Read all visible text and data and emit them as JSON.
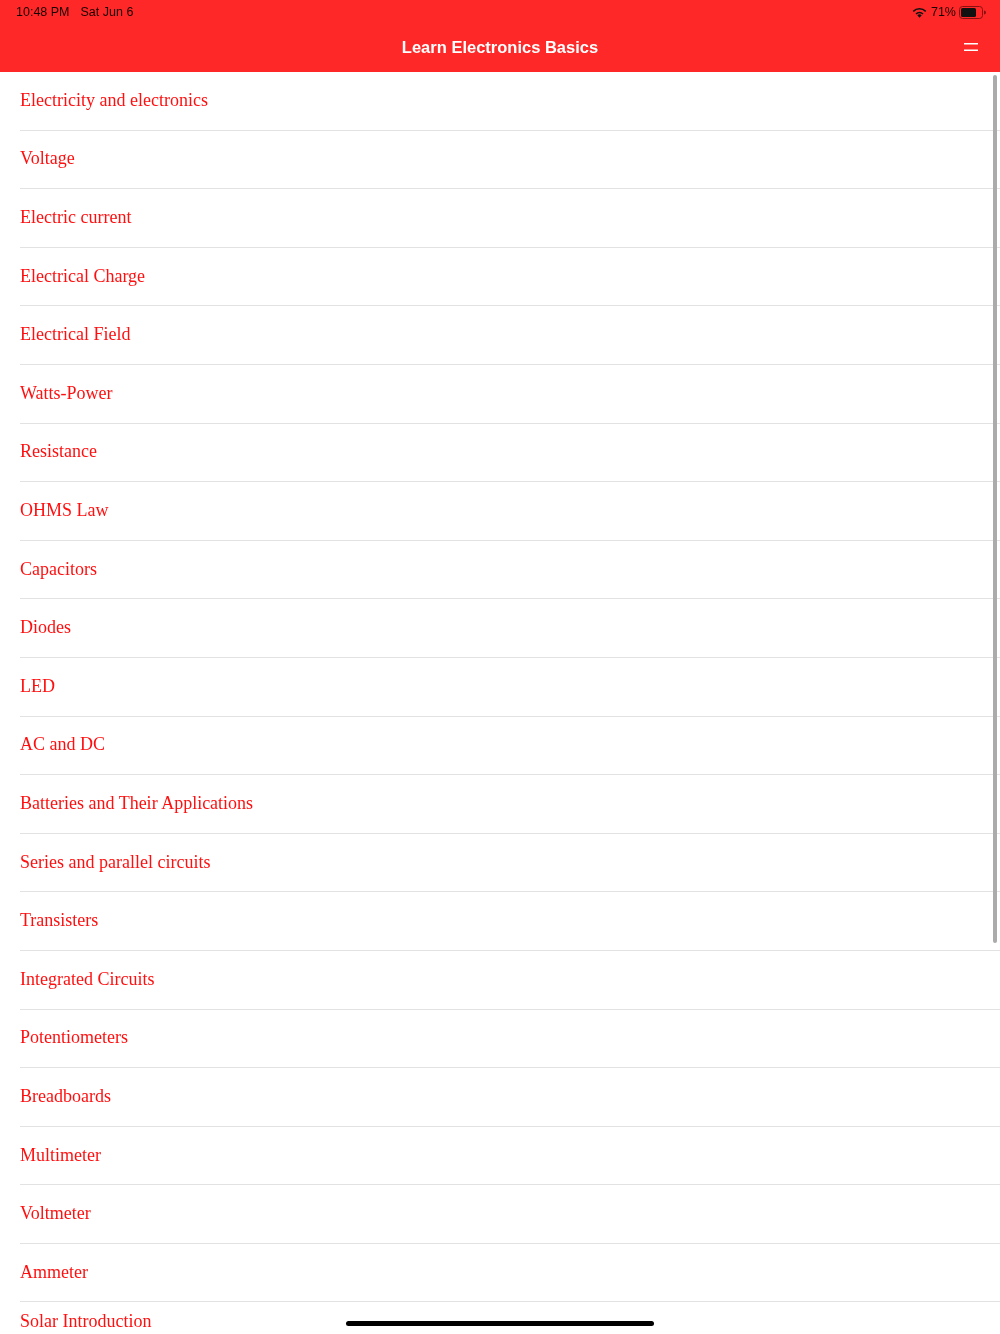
{
  "status_bar": {
    "time": "10:48 PM",
    "date": "Sat Jun 6",
    "battery": "71%"
  },
  "nav_bar": {
    "title": "Learn Electronics Basics"
  },
  "topics": [
    {
      "label": "Electricity and electronics"
    },
    {
      "label": "Voltage"
    },
    {
      "label": "Electric current"
    },
    {
      "label": "Electrical Charge"
    },
    {
      "label": "Electrical Field"
    },
    {
      "label": "Watts-Power"
    },
    {
      "label": "Resistance"
    },
    {
      "label": "OHMS Law"
    },
    {
      "label": "Capacitors"
    },
    {
      "label": "Diodes"
    },
    {
      "label": "LED"
    },
    {
      "label": "AC and DC"
    },
    {
      "label": "Batteries and Their Applications"
    },
    {
      "label": "Series and parallel circuits"
    },
    {
      "label": "Transisters"
    },
    {
      "label": "Integrated Circuits"
    },
    {
      "label": "Potentiometers"
    },
    {
      "label": "Breadboards"
    },
    {
      "label": "Multimeter"
    },
    {
      "label": "Voltmeter"
    },
    {
      "label": "Ammeter"
    },
    {
      "label": "Solar Introduction"
    }
  ]
}
